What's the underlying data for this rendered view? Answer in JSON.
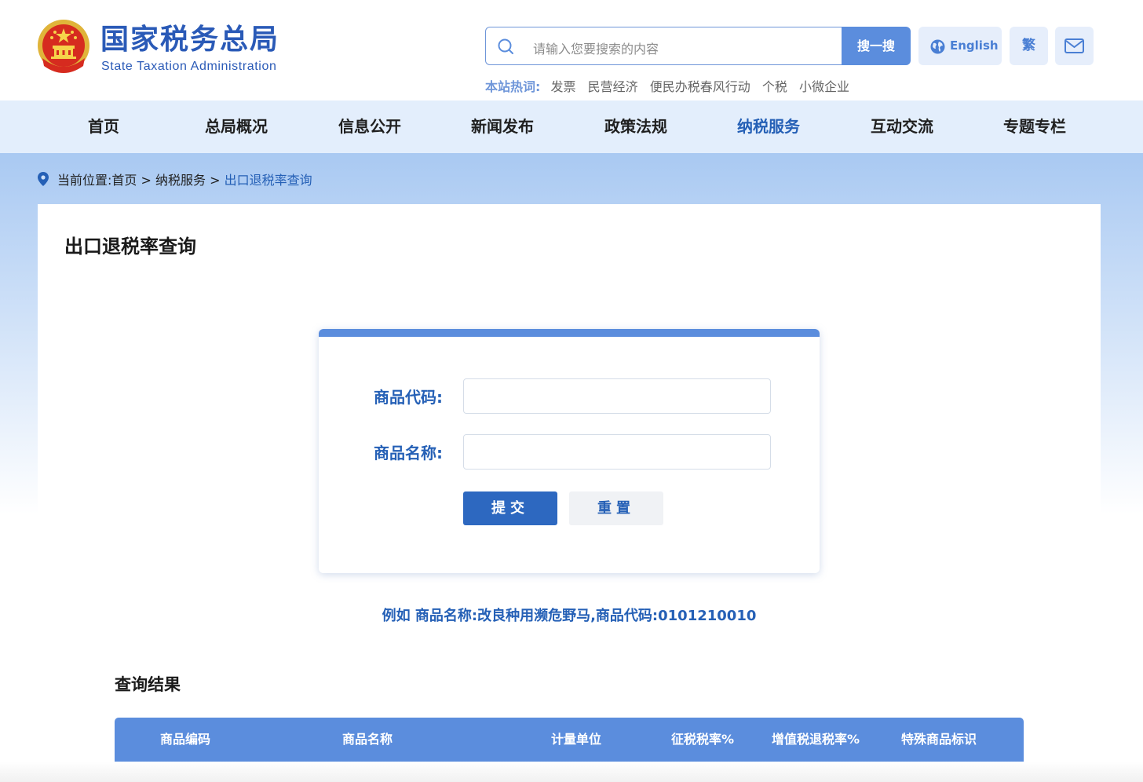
{
  "header": {
    "logo_cn": "国家税务总局",
    "logo_en": "State Taxation Administration",
    "search_placeholder": "请输入您要搜索的内容",
    "search_button": "搜一搜",
    "english_button": "English",
    "traditional_button": "繁",
    "hot_label": "本站热词:",
    "hot_words": [
      "发票",
      "民营经济",
      "便民办税春风行动",
      "个税",
      "小微企业"
    ]
  },
  "nav": {
    "items": [
      "首页",
      "总局概况",
      "信息公开",
      "新闻发布",
      "政策法规",
      "纳税服务",
      "互动交流",
      "专题专栏"
    ],
    "active": "纳税服务"
  },
  "breadcrumb": {
    "prefix": "当前位置:",
    "path": "首页 > 纳税服务 > ",
    "current": "出口退税率查询"
  },
  "page": {
    "title": "出口退税率查询"
  },
  "form": {
    "code_label": "商品代码:",
    "code_value": "",
    "name_label": "商品名称:",
    "name_value": "",
    "submit": "提交",
    "reset": "重置"
  },
  "example": "例如 商品名称:改良种用濒危野马,商品代码:0101210010",
  "results": {
    "title": "查询结果",
    "columns": [
      "商品编码",
      "商品名称",
      "计量单位",
      "征税税率%",
      "增值税退税率%",
      "特殊商品标识"
    ]
  },
  "colors": {
    "primary": "#2560b6",
    "accent": "#5b8ddd",
    "nav_bg": "#e3eefc"
  }
}
